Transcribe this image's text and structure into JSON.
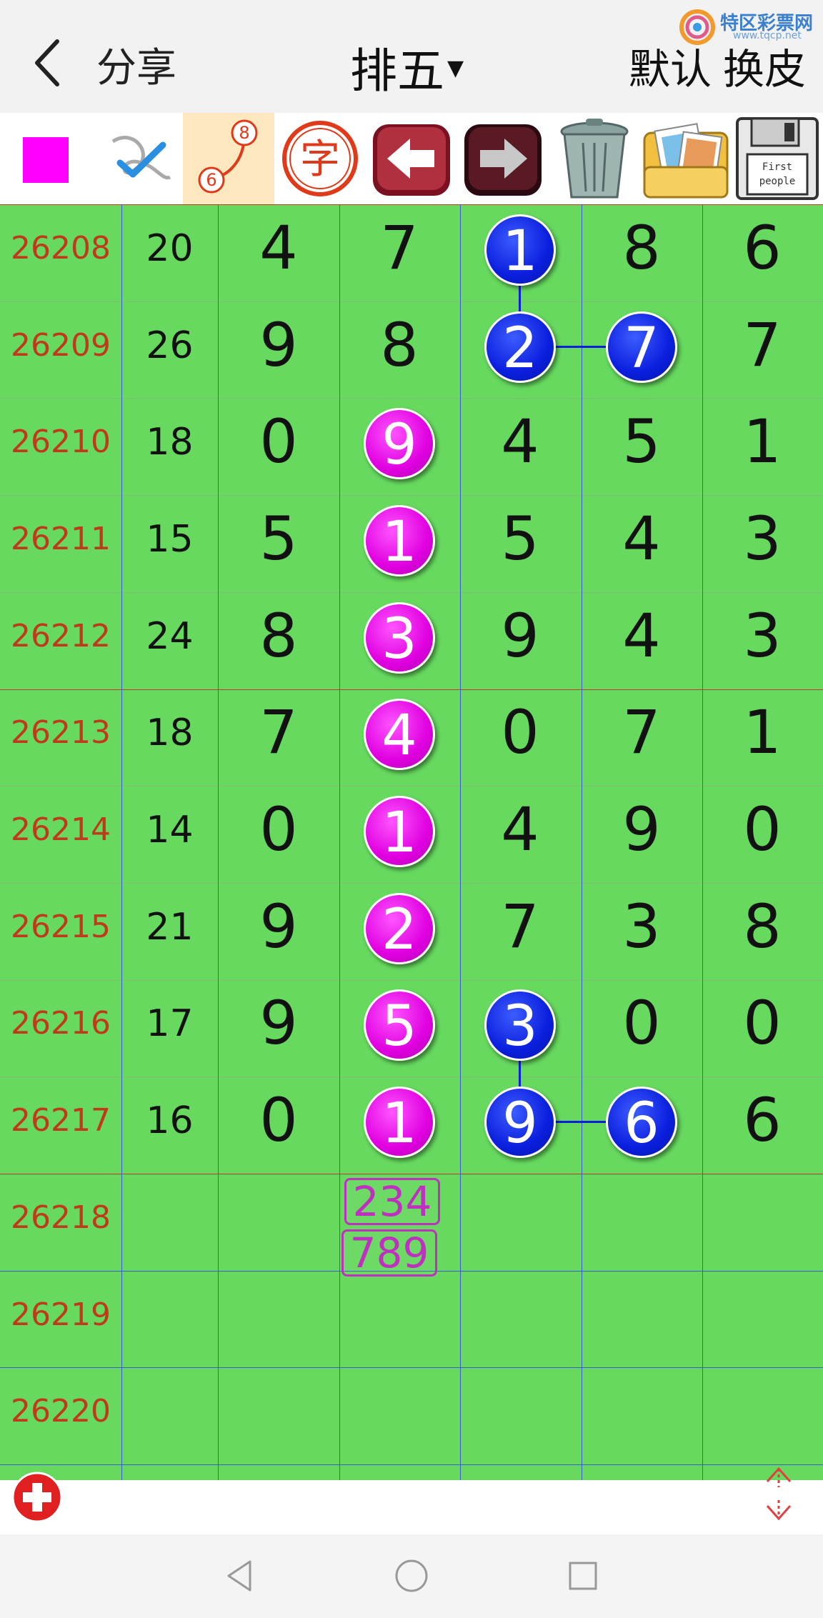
{
  "header": {
    "share_label": "分享",
    "title": "排五",
    "default_label": "默认",
    "skin_label": "换皮",
    "watermark_text": "特区彩票网",
    "watermark_sub": "www.tqcp.net"
  },
  "toolbar": {
    "color_swatch": "#ff00ff",
    "tools": [
      "color-picker",
      "pen-tool",
      "connect-tool",
      "text-tool",
      "undo",
      "redo",
      "trash",
      "images",
      "save"
    ],
    "connect_tool_digits": [
      "8",
      "6"
    ],
    "text_tool_label": "字",
    "save_icon_text": [
      "First",
      "people"
    ]
  },
  "rows": [
    {
      "id": "26208",
      "sum": "20",
      "digits": [
        "4",
        "7",
        "1",
        "8",
        "6"
      ]
    },
    {
      "id": "26209",
      "sum": "26",
      "digits": [
        "9",
        "8",
        "2",
        "7",
        "7"
      ]
    },
    {
      "id": "26210",
      "sum": "18",
      "digits": [
        "0",
        "9",
        "4",
        "5",
        "1"
      ]
    },
    {
      "id": "26211",
      "sum": "15",
      "digits": [
        "5",
        "1",
        "5",
        "4",
        "3"
      ]
    },
    {
      "id": "26212",
      "sum": "24",
      "digits": [
        "8",
        "3",
        "9",
        "4",
        "3"
      ]
    },
    {
      "id": "26213",
      "sum": "18",
      "digits": [
        "7",
        "4",
        "0",
        "7",
        "1"
      ]
    },
    {
      "id": "26214",
      "sum": "14",
      "digits": [
        "0",
        "1",
        "4",
        "9",
        "0"
      ]
    },
    {
      "id": "26215",
      "sum": "21",
      "digits": [
        "9",
        "2",
        "7",
        "3",
        "8"
      ]
    },
    {
      "id": "26216",
      "sum": "17",
      "digits": [
        "9",
        "5",
        "3",
        "0",
        "0"
      ]
    },
    {
      "id": "26217",
      "sum": "16",
      "digits": [
        "0",
        "1",
        "9",
        "6",
        "6"
      ]
    },
    {
      "id": "26218",
      "sum": "",
      "digits": [
        "",
        "",
        "",
        "",
        ""
      ]
    },
    {
      "id": "26219",
      "sum": "",
      "digits": [
        "",
        "",
        "",
        "",
        ""
      ]
    },
    {
      "id": "26220",
      "sum": "",
      "digits": [
        "",
        "",
        "",
        "",
        ""
      ]
    }
  ],
  "prediction": [
    "234",
    "789"
  ],
  "marks": {
    "magenta_color": "#e000e0",
    "blue_color": "#0a1edd",
    "grid_bg": "#66d95e"
  }
}
